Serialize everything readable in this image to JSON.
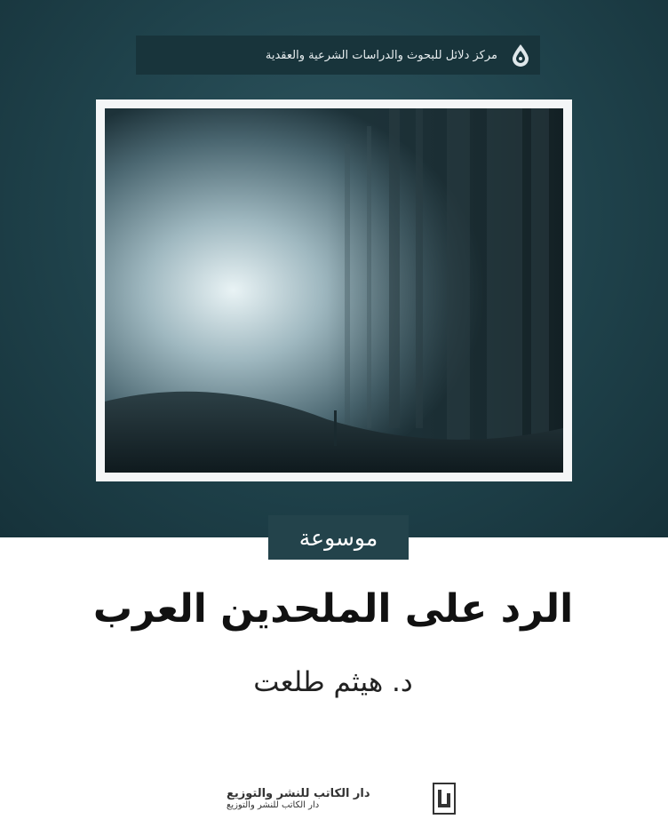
{
  "banner": {
    "text": "مركز دلائل للبحوث والدراسات الشرعية والعقدية",
    "logo_icon": "drop-emblem-icon"
  },
  "series_label": "موسوعة",
  "title": "الرد على الملحدين العرب",
  "author": "د. هيثم طلعت",
  "publisher": {
    "line1": "دار الكاتب للنشر والتوزيع",
    "line2": "دار الكاتب للنشر والتوزيع",
    "logo_icon": "publisher-logo-icon"
  },
  "colors": {
    "top_background": "#1f424b",
    "banner_background": "#18343b",
    "series_background": "#23434b",
    "frame": "#f4f6f7",
    "bottom_background": "#ffffff",
    "title_text": "#111111"
  }
}
